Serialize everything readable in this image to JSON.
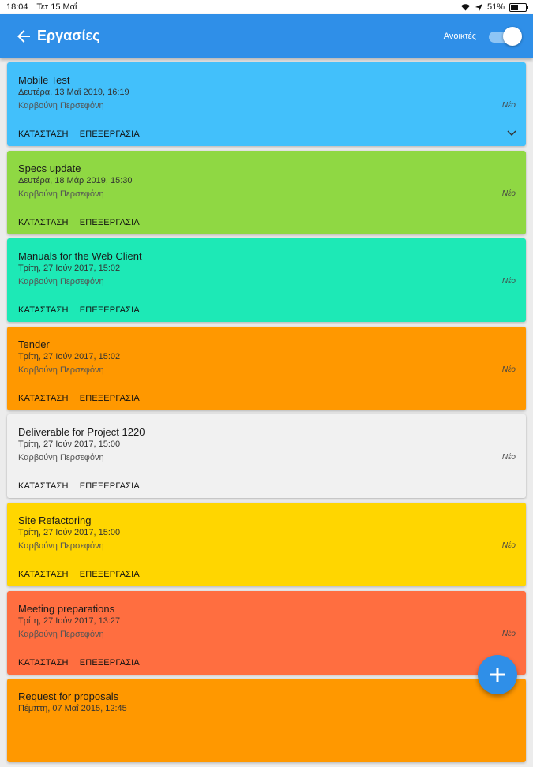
{
  "status_bar": {
    "time": "18:04",
    "date": "Τετ 15 Μαΐ",
    "battery": "51%"
  },
  "appbar": {
    "title": "Εργασίες",
    "toggle_label": "Ανοικτές",
    "toggle_on": true,
    "color": "#2f8fe8"
  },
  "tasks": [
    {
      "title": "Mobile Test",
      "date": "Δευτέρα, 13 Μαΐ 2019, 16:19",
      "owner": "Καρβούνη Περσεφόνη",
      "status": "Νέο",
      "action_status": "ΚΑΤΑΣΤΑΣΗ",
      "action_edit": "ΕΠΕΞΕΡΓΑΣΙΑ",
      "color": "#42c0fb"
    },
    {
      "title": "Specs update",
      "date": "Δευτέρα, 18 Μάρ 2019, 15:30",
      "owner": "Καρβούνη Περσεφόνη",
      "status": "Νέο",
      "action_status": "ΚΑΤΑΣΤΑΣΗ",
      "action_edit": "ΕΠΕΞΕΡΓΑΣΙΑ",
      "color": "#8fd843"
    },
    {
      "title": "Manuals for the Web Client",
      "date": "Τρίτη, 27 Ιούν 2017, 15:02",
      "owner": "Καρβούνη Περσεφόνη",
      "status": "Νέο",
      "action_status": "ΚΑΤΑΣΤΑΣΗ",
      "action_edit": "ΕΠΕΞΕΡΓΑΣΙΑ",
      "color": "#1de9b6"
    },
    {
      "title": "Tender",
      "date": "Τρίτη, 27 Ιούν 2017, 15:02",
      "owner": "Καρβούνη Περσεφόνη",
      "status": "Νέο",
      "action_status": "ΚΑΤΑΣΤΑΣΗ",
      "action_edit": "ΕΠΕΞΕΡΓΑΣΙΑ",
      "color": "#ff9800"
    },
    {
      "title": "Deliverable for Project 1220",
      "date": "Τρίτη, 27 Ιούν 2017, 15:00",
      "owner": "Καρβούνη Περσεφόνη",
      "status": "Νέο",
      "action_status": "ΚΑΤΑΣΤΑΣΗ",
      "action_edit": "ΕΠΕΞΕΡΓΑΣΙΑ",
      "color": "#f1f1f1"
    },
    {
      "title": "Site Refactoring",
      "date": "Τρίτη, 27 Ιούν 2017, 15:00",
      "owner": "Καρβούνη Περσεφόνη",
      "status": "Νέο",
      "action_status": "ΚΑΤΑΣΤΑΣΗ",
      "action_edit": "ΕΠΕΞΕΡΓΑΣΙΑ",
      "color": "#ffd600"
    },
    {
      "title": "Meeting preparations",
      "date": "Τρίτη, 27 Ιούν 2017, 13:27",
      "owner": "Καρβούνη Περσεφόνη",
      "status": "Νέο",
      "action_status": "ΚΑΤΑΣΤΑΣΗ",
      "action_edit": "ΕΠΕΞΕΡΓΑΣΙΑ",
      "color": "#ff6e40"
    },
    {
      "title": "Request for proposals",
      "date": "Πέμπτη, 07 Μαΐ 2015, 12:45",
      "owner": "",
      "status": "",
      "action_status": "",
      "action_edit": "",
      "color": "#ff9800"
    }
  ],
  "icons": {
    "back": "arrow-left-icon",
    "expand": "chevron-down-icon",
    "add": "plus-icon",
    "wifi": "wifi-icon",
    "location": "location-arrow-icon",
    "battery": "battery-icon"
  }
}
